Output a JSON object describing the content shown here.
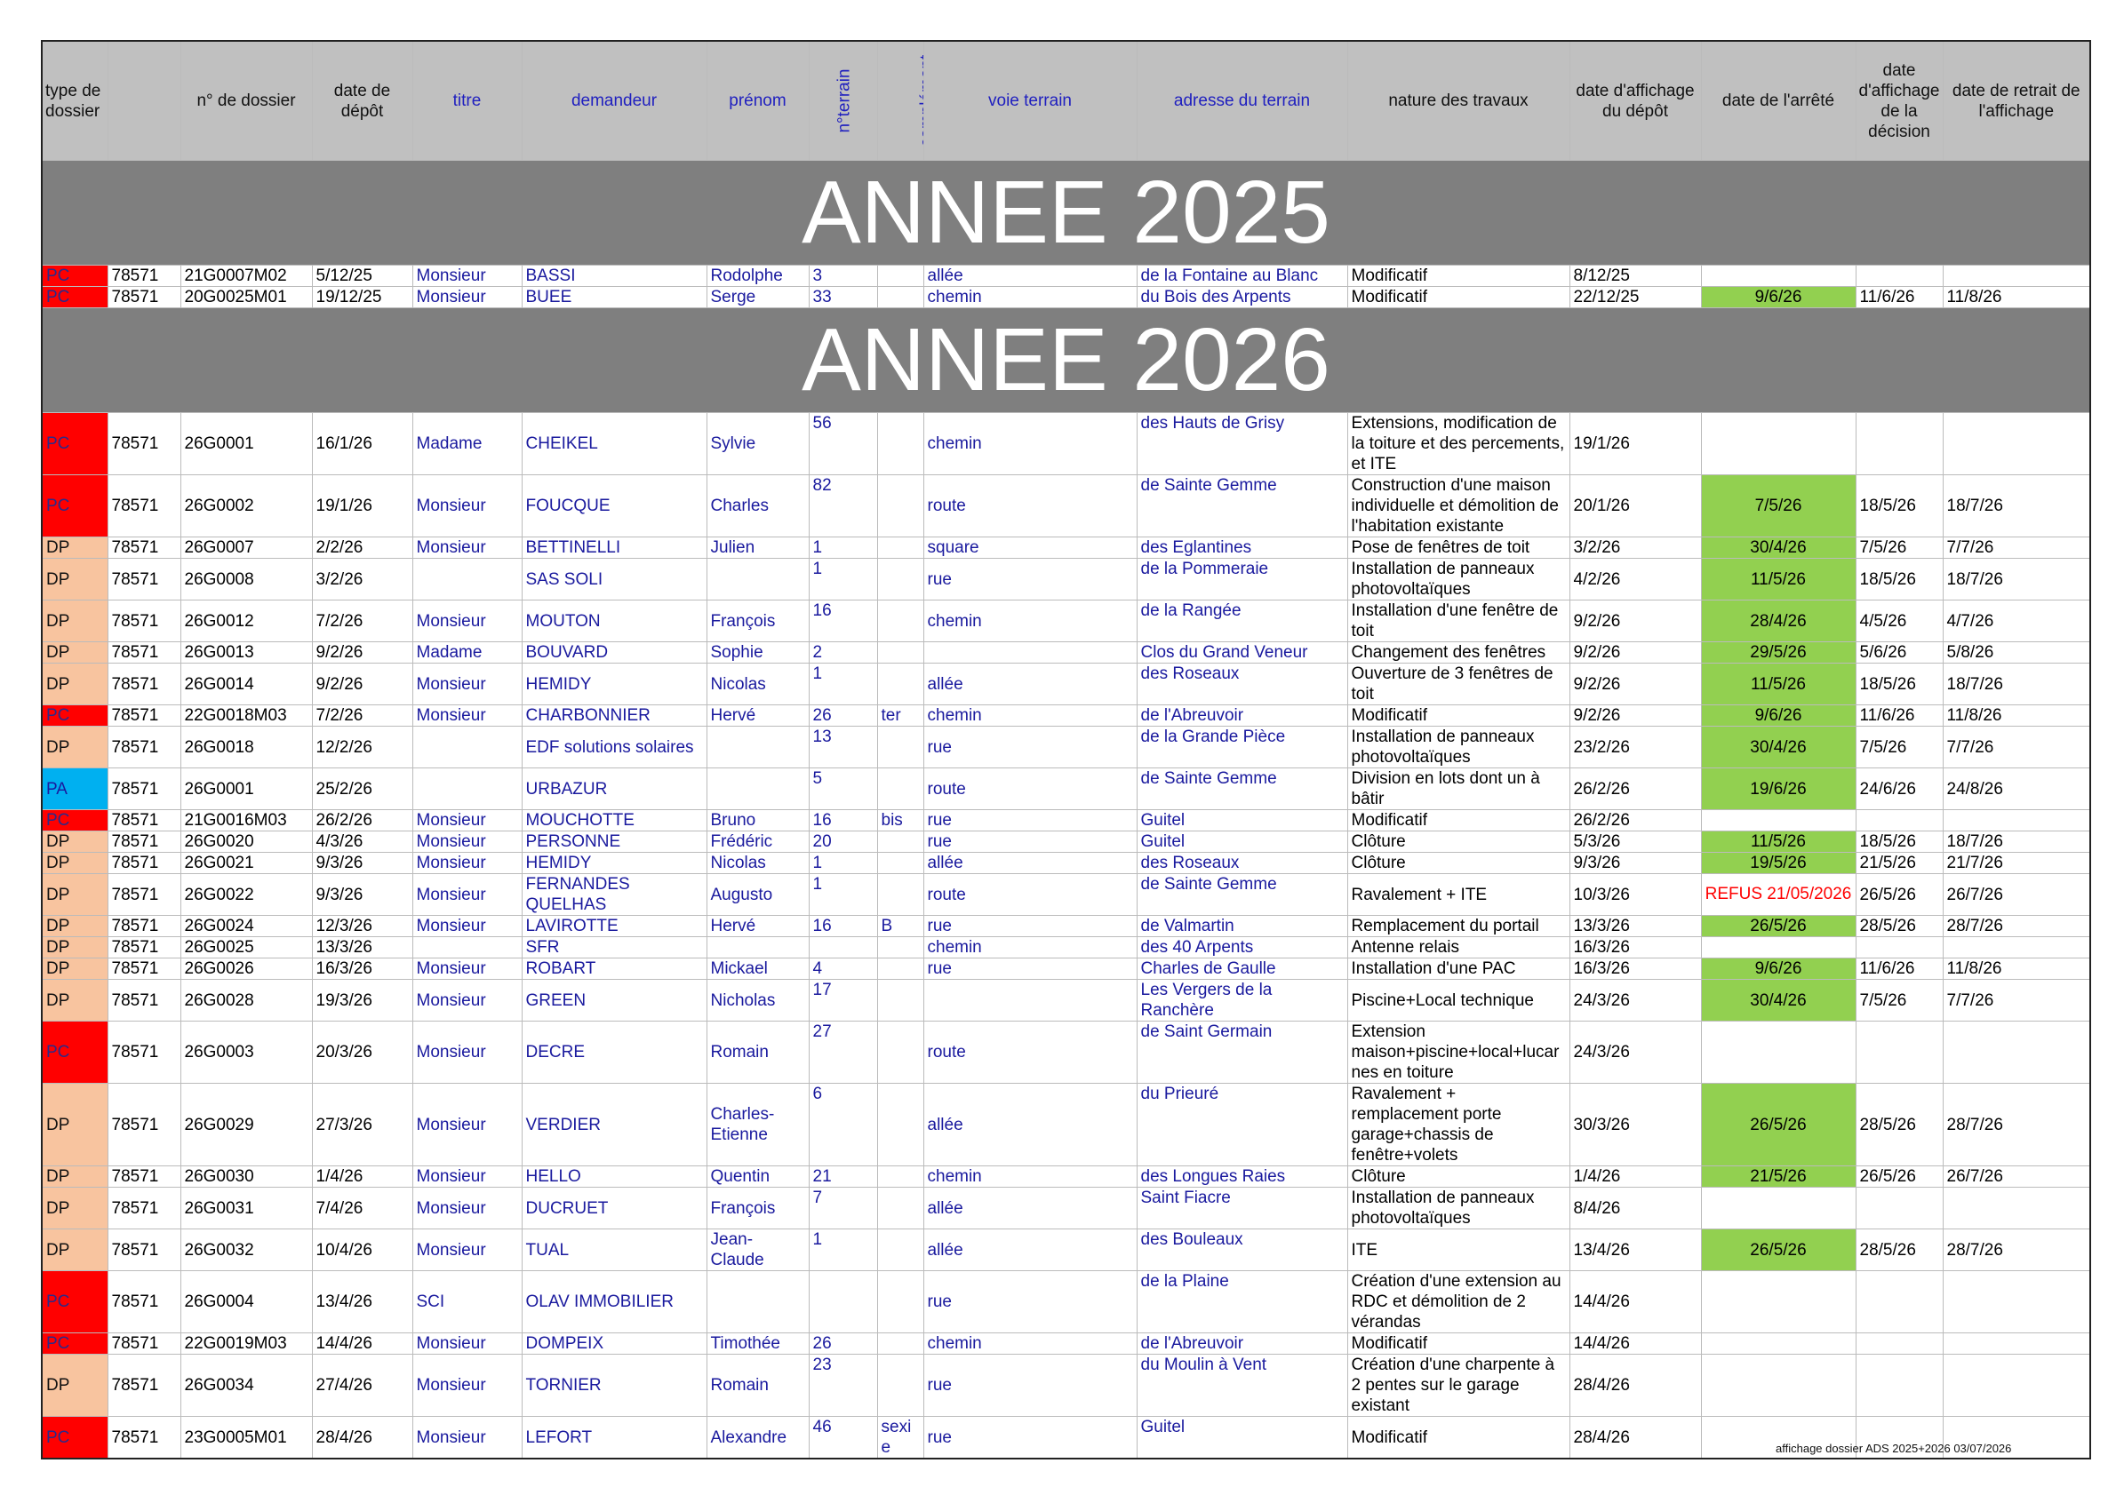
{
  "headers": {
    "type": "type de dossier",
    "code": "",
    "numero": "n° de dossier",
    "date_depot": "date de dépôt",
    "titre": "titre",
    "demandeur": "demandeur",
    "prenom": "prénom",
    "n_terrain": "n°terrain",
    "complement": "complément",
    "voie": "voie terrain",
    "adresse": "adresse du terrain",
    "nature": "nature des travaux",
    "date_affichage": "date d'affichage du dépôt",
    "date_arrete": "date de l'arrêté",
    "date_affichage_decision": "date d'affichage de la décision",
    "date_retrait": "date de retrait de l'affichage"
  },
  "sections": [
    {
      "title": "ANNEE 2025",
      "rows": [
        {
          "type": "PC",
          "code": "78571",
          "numero": "21G0007M02",
          "date_depot": "5/12/25",
          "titre": "Monsieur",
          "demandeur": "BASSI",
          "prenom": "Rodolphe",
          "n_terrain": "3",
          "complement": "",
          "voie": "allée",
          "adresse": "de la Fontaine au Blanc",
          "nature": "Modificatif",
          "date_affichage": "8/12/25",
          "date_arrete": "",
          "date_affichage_decision": "",
          "date_retrait": ""
        },
        {
          "type": "PC",
          "code": "78571",
          "numero": "20G0025M01",
          "date_depot": "19/12/25",
          "titre": "Monsieur",
          "demandeur": "BUEE",
          "prenom": "Serge",
          "n_terrain": "33",
          "complement": "",
          "voie": "chemin",
          "adresse": "du Bois des Arpents",
          "nature": "Modificatif",
          "date_affichage": "22/12/25",
          "date_arrete": "9/6/26",
          "date_affichage_decision": "11/6/26",
          "date_retrait": "11/8/26"
        }
      ]
    },
    {
      "title": "ANNEE 2026",
      "rows": [
        {
          "type": "PC",
          "code": "78571",
          "numero": "26G0001",
          "date_depot": "16/1/26",
          "titre": "Madame",
          "demandeur": "CHEIKEL",
          "prenom": "Sylvie",
          "n_terrain": "56",
          "complement": "",
          "voie": "chemin",
          "adresse": "des Hauts de Grisy",
          "nature": "Extensions, modification de la toiture et des percements, et ITE",
          "date_affichage": "19/1/26",
          "date_arrete": "",
          "date_affichage_decision": "",
          "date_retrait": ""
        },
        {
          "type": "PC",
          "code": "78571",
          "numero": "26G0002",
          "date_depot": "19/1/26",
          "titre": "Monsieur",
          "demandeur": "FOUCQUE",
          "prenom": "Charles",
          "n_terrain": "82",
          "complement": "",
          "voie": "route",
          "adresse": "de Sainte Gemme",
          "nature": "Construction d'une maison individuelle et démolition de l'habitation existante",
          "date_affichage": "20/1/26",
          "date_arrete": "7/5/26",
          "date_affichage_decision": "18/5/26",
          "date_retrait": "18/7/26"
        },
        {
          "type": "DP",
          "code": "78571",
          "numero": "26G0007",
          "date_depot": "2/2/26",
          "titre": "Monsieur",
          "demandeur": "BETTINELLI",
          "prenom": "Julien",
          "n_terrain": "1",
          "complement": "",
          "voie": "square",
          "adresse": "des Eglantines",
          "nature": "Pose de fenêtres de toit",
          "date_affichage": "3/2/26",
          "date_arrete": "30/4/26",
          "date_affichage_decision": "7/5/26",
          "date_retrait": "7/7/26"
        },
        {
          "type": "DP",
          "code": "78571",
          "numero": "26G0008",
          "date_depot": "3/2/26",
          "titre": "",
          "demandeur": "SAS SOLI",
          "prenom": "",
          "n_terrain": "1",
          "complement": "",
          "voie": "rue",
          "adresse": "de la Pommeraie",
          "nature": "Installation de panneaux photovoltaïques",
          "date_affichage": "4/2/26",
          "date_arrete": "11/5/26",
          "date_affichage_decision": "18/5/26",
          "date_retrait": "18/7/26"
        },
        {
          "type": "DP",
          "code": "78571",
          "numero": "26G0012",
          "date_depot": "7/2/26",
          "titre": "Monsieur",
          "demandeur": "MOUTON",
          "prenom": "François",
          "n_terrain": "16",
          "complement": "",
          "voie": "chemin",
          "adresse": "de la Rangée",
          "nature": "Installation d'une fenêtre de toit",
          "date_affichage": "9/2/26",
          "date_arrete": "28/4/26",
          "date_affichage_decision": "4/5/26",
          "date_retrait": "4/7/26"
        },
        {
          "type": "DP",
          "code": "78571",
          "numero": "26G0013",
          "date_depot": "9/2/26",
          "titre": "Madame",
          "demandeur": "BOUVARD",
          "prenom": "Sophie",
          "n_terrain": "2",
          "complement": "",
          "voie": "",
          "adresse": "Clos du Grand Veneur",
          "nature": "Changement des fenêtres",
          "date_affichage": "9/2/26",
          "date_arrete": "29/5/26",
          "date_affichage_decision": "5/6/26",
          "date_retrait": "5/8/26"
        },
        {
          "type": "DP",
          "code": "78571",
          "numero": "26G0014",
          "date_depot": "9/2/26",
          "titre": "Monsieur",
          "demandeur": "HEMIDY",
          "prenom": "Nicolas",
          "n_terrain": "1",
          "complement": "",
          "voie": "allée",
          "adresse": "des Roseaux",
          "nature": "Ouverture de 3 fenêtres de toit",
          "date_affichage": "9/2/26",
          "date_arrete": "11/5/26",
          "date_affichage_decision": "18/5/26",
          "date_retrait": "18/7/26"
        },
        {
          "type": "PC",
          "code": "78571",
          "numero": "22G0018M03",
          "date_depot": "7/2/26",
          "titre": "Monsieur",
          "demandeur": "CHARBONNIER",
          "prenom": "Hervé",
          "n_terrain": "26",
          "complement": "ter",
          "voie": "chemin",
          "adresse": "de l'Abreuvoir",
          "nature": "Modificatif",
          "date_affichage": "9/2/26",
          "date_arrete": "9/6/26",
          "date_affichage_decision": "11/6/26",
          "date_retrait": "11/8/26"
        },
        {
          "type": "DP",
          "code": "78571",
          "numero": "26G0018",
          "date_depot": "12/2/26",
          "titre": "",
          "demandeur": "EDF solutions solaires",
          "prenom": "",
          "n_terrain": "13",
          "complement": "",
          "voie": "rue",
          "adresse": "de la Grande Pièce",
          "nature": "Installation de panneaux photovoltaïques",
          "date_affichage": "23/2/26",
          "date_arrete": "30/4/26",
          "date_affichage_decision": "7/5/26",
          "date_retrait": "7/7/26"
        },
        {
          "type": "PA",
          "code": "78571",
          "numero": "26G0001",
          "date_depot": "25/2/26",
          "titre": "",
          "demandeur": "URBAZUR",
          "prenom": "",
          "n_terrain": "5",
          "complement": "",
          "voie": "route",
          "adresse": "de Sainte Gemme",
          "nature": "Division en lots dont un à bâtir",
          "date_affichage": "26/2/26",
          "date_arrete": "19/6/26",
          "date_affichage_decision": "24/6/26",
          "date_retrait": "24/8/26"
        },
        {
          "type": "PC",
          "code": "78571",
          "numero": "21G0016M03",
          "date_depot": "26/2/26",
          "titre": "Monsieur",
          "demandeur": "MOUCHOTTE",
          "prenom": "Bruno",
          "n_terrain": "16",
          "complement": "bis",
          "voie": "rue",
          "adresse": "Guitel",
          "nature": "Modificatif",
          "date_affichage": "26/2/26",
          "date_arrete": "",
          "date_affichage_decision": "",
          "date_retrait": ""
        },
        {
          "type": "DP",
          "code": "78571",
          "numero": "26G0020",
          "date_depot": "4/3/26",
          "titre": "Monsieur",
          "demandeur": "PERSONNE",
          "prenom": "Frédéric",
          "n_terrain": "20",
          "complement": "",
          "voie": "rue",
          "adresse": "Guitel",
          "nature": "Clôture",
          "date_affichage": "5/3/26",
          "date_arrete": "11/5/26",
          "date_affichage_decision": "18/5/26",
          "date_retrait": "18/7/26"
        },
        {
          "type": "DP",
          "code": "78571",
          "numero": "26G0021",
          "date_depot": "9/3/26",
          "titre": "Monsieur",
          "demandeur": "HEMIDY",
          "prenom": "Nicolas",
          "n_terrain": "1",
          "complement": "",
          "voie": "allée",
          "adresse": "des Roseaux",
          "nature": "Clôture",
          "date_affichage": "9/3/26",
          "date_arrete": "19/5/26",
          "date_affichage_decision": "21/5/26",
          "date_retrait": "21/7/26"
        },
        {
          "type": "DP",
          "code": "78571",
          "numero": "26G0022",
          "date_depot": "9/3/26",
          "titre": "Monsieur",
          "demandeur": "FERNANDES QUELHAS",
          "prenom": "Augusto",
          "n_terrain": "1",
          "complement": "",
          "voie": "route",
          "adresse": " de Sainte Gemme",
          "nature": "Ravalement + ITE",
          "date_affichage": "10/3/26",
          "date_arrete": "REFUS 21/05/2026",
          "date_affichage_decision": "26/5/26",
          "date_retrait": "26/7/26"
        },
        {
          "type": "DP",
          "code": "78571",
          "numero": "26G0024",
          "date_depot": "12/3/26",
          "titre": "Monsieur",
          "demandeur": "LAVIROTTE",
          "prenom": "Hervé",
          "n_terrain": "16",
          "complement": "B",
          "voie": "rue",
          "adresse": "de Valmartin",
          "nature": "Remplacement du portail",
          "date_affichage": "13/3/26",
          "date_arrete": "26/5/26",
          "date_affichage_decision": "28/5/26",
          "date_retrait": "28/7/26"
        },
        {
          "type": "DP",
          "code": "78571",
          "numero": "26G0025",
          "date_depot": "13/3/26",
          "titre": "",
          "demandeur": "SFR",
          "prenom": "",
          "n_terrain": "",
          "complement": "",
          "voie": "chemin",
          "adresse": "des 40 Arpents",
          "nature": "Antenne relais",
          "date_affichage": "16/3/26",
          "date_arrete": "",
          "date_affichage_decision": "",
          "date_retrait": ""
        },
        {
          "type": "DP",
          "code": "78571",
          "numero": "26G0026",
          "date_depot": "16/3/26",
          "titre": "Monsieur",
          "demandeur": "ROBART",
          "prenom": "Mickael",
          "n_terrain": "4",
          "complement": "",
          "voie": "rue",
          "adresse": "Charles de Gaulle",
          "nature": "Installation d'une PAC",
          "date_affichage": "16/3/26",
          "date_arrete": "9/6/26",
          "date_affichage_decision": "11/6/26",
          "date_retrait": "11/8/26"
        },
        {
          "type": "DP",
          "code": "78571",
          "numero": "26G0028",
          "date_depot": "19/3/26",
          "titre": "Monsieur",
          "demandeur": "GREEN",
          "prenom": "Nicholas",
          "n_terrain": "17",
          "complement": "",
          "voie": "",
          "adresse": "Les Vergers de la Ranchère",
          "nature": "Piscine+Local technique",
          "date_affichage": "24/3/26",
          "date_arrete": "30/4/26",
          "date_affichage_decision": "7/5/26",
          "date_retrait": "7/7/26"
        },
        {
          "type": "PC",
          "code": "78571",
          "numero": "26G0003",
          "date_depot": "20/3/26",
          "titre": "Monsieur",
          "demandeur": "DECRE",
          "prenom": "Romain",
          "n_terrain": "27",
          "complement": "",
          "voie": "route",
          "adresse": "de Saint Germain",
          "nature": "Extension maison+piscine+local+lucarnes en toiture",
          "date_affichage": "24/3/26",
          "date_arrete": "",
          "date_affichage_decision": "",
          "date_retrait": ""
        },
        {
          "type": "DP",
          "code": "78571",
          "numero": "26G0029",
          "date_depot": "27/3/26",
          "titre": "Monsieur",
          "demandeur": "VERDIER",
          "prenom": "Charles-Etienne",
          "n_terrain": "6",
          "complement": "",
          "voie": "allée",
          "adresse": "du Prieuré",
          "nature": "Ravalement + remplacement porte garage+chassis de fenêtre+volets",
          "date_affichage": "30/3/26",
          "date_arrete": "26/5/26",
          "date_affichage_decision": "28/5/26",
          "date_retrait": "28/7/26"
        },
        {
          "type": "DP",
          "code": "78571",
          "numero": "26G0030",
          "date_depot": "1/4/26",
          "titre": "Monsieur",
          "demandeur": "HELLO",
          "prenom": "Quentin",
          "n_terrain": "21",
          "complement": "",
          "voie": "chemin",
          "adresse": "des Longues Raies",
          "nature": "Clôture",
          "date_affichage": "1/4/26",
          "date_arrete": "21/5/26",
          "date_affichage_decision": "26/5/26",
          "date_retrait": "26/7/26"
        },
        {
          "type": "DP",
          "code": "78571",
          "numero": "26G0031",
          "date_depot": "7/4/26",
          "titre": "Monsieur",
          "demandeur": "DUCRUET",
          "prenom": "François",
          "n_terrain": "7",
          "complement": "",
          "voie": "allée",
          "adresse": "Saint Fiacre",
          "nature": "Installation de panneaux photovoltaïques",
          "date_affichage": "8/4/26",
          "date_arrete": "",
          "date_affichage_decision": "",
          "date_retrait": ""
        },
        {
          "type": "DP",
          "code": "78571",
          "numero": "26G0032",
          "date_depot": "10/4/26",
          "titre": "Monsieur",
          "demandeur": "TUAL",
          "prenom": "Jean-Claude",
          "n_terrain": "1",
          "complement": "",
          "voie": "allée",
          "adresse": "des Bouleaux",
          "nature": "ITE",
          "date_affichage": "13/4/26",
          "date_arrete": "26/5/26",
          "date_affichage_decision": "28/5/26",
          "date_retrait": "28/7/26"
        },
        {
          "type": "PC",
          "code": "78571",
          "numero": "26G0004",
          "date_depot": "13/4/26",
          "titre": "SCI",
          "demandeur": "OLAV IMMOBILIER",
          "prenom": "",
          "n_terrain": "",
          "complement": "",
          "voie": "rue",
          "adresse": "de la Plaine",
          "nature": "Création d'une extension au RDC et démolition de 2 vérandas",
          "date_affichage": "14/4/26",
          "date_arrete": "",
          "date_affichage_decision": "",
          "date_retrait": ""
        },
        {
          "type": "PC",
          "code": "78571",
          "numero": "22G0019M03",
          "date_depot": "14/4/26",
          "titre": "Monsieur",
          "demandeur": "DOMPEIX",
          "prenom": "Timothée",
          "n_terrain": "26",
          "complement": "",
          "voie": "chemin",
          "adresse": "de l'Abreuvoir",
          "nature": "Modificatif",
          "date_affichage": "14/4/26",
          "date_arrete": "",
          "date_affichage_decision": "",
          "date_retrait": ""
        },
        {
          "type": "DP",
          "code": "78571",
          "numero": "26G0034",
          "date_depot": "27/4/26",
          "titre": "Monsieur",
          "demandeur": "TORNIER",
          "prenom": "Romain",
          "n_terrain": "23",
          "complement": "",
          "voie": "rue",
          "adresse": "du Moulin à Vent",
          "nature": "Création d'une charpente à 2 pentes sur le garage existant",
          "date_affichage": "28/4/26",
          "date_arrete": "",
          "date_affichage_decision": "",
          "date_retrait": ""
        },
        {
          "type": "PC",
          "code": "78571",
          "numero": "23G0005M01",
          "date_depot": "28/4/26",
          "titre": "Monsieur",
          "demandeur": "LEFORT",
          "prenom": "Alexandre",
          "n_terrain": "46",
          "complement": "sexie",
          "voie": "rue",
          "adresse": "Guitel",
          "nature": "Modificatif",
          "date_affichage": "28/4/26",
          "date_arrete": "",
          "date_affichage_decision": "",
          "date_retrait": ""
        }
      ]
    }
  ],
  "footer": "affichage dossier ADS 2025+2026 03/07/2026",
  "colors": {
    "PC": "#ff0000",
    "DP": "#f8c49f",
    "PA": "#00b0f0",
    "arrete": "#92d050",
    "year_band": "#7f7f7f",
    "header": "#c0c0c0",
    "refus": "#ff0000"
  }
}
